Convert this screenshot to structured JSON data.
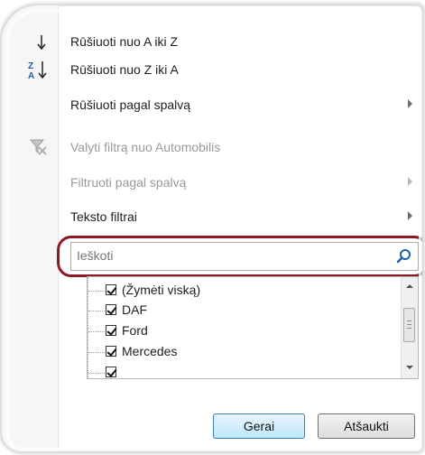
{
  "menu": {
    "sort_az": "Rūšiuoti nuo A iki Z",
    "sort_za": "Rūšiuoti nuo Z iki A",
    "sort_by_color": "Rūšiuoti pagal spalvą",
    "clear_filter": "Valyti filtrą nuo Automobilis",
    "filter_by_color": "Filtruoti pagal spalvą",
    "text_filters": "Teksto filtrai"
  },
  "search": {
    "placeholder": "Ieškoti"
  },
  "list": {
    "items": [
      {
        "label": "(Žymėti viską)",
        "checked": true
      },
      {
        "label": "DAF",
        "checked": true
      },
      {
        "label": "Ford",
        "checked": true
      },
      {
        "label": "Mercedes",
        "checked": true
      }
    ]
  },
  "buttons": {
    "ok": "Gerai",
    "cancel": "Atšaukti"
  },
  "colors": {
    "highlight": "#8b1a25",
    "accent": "#1c5fa8"
  }
}
